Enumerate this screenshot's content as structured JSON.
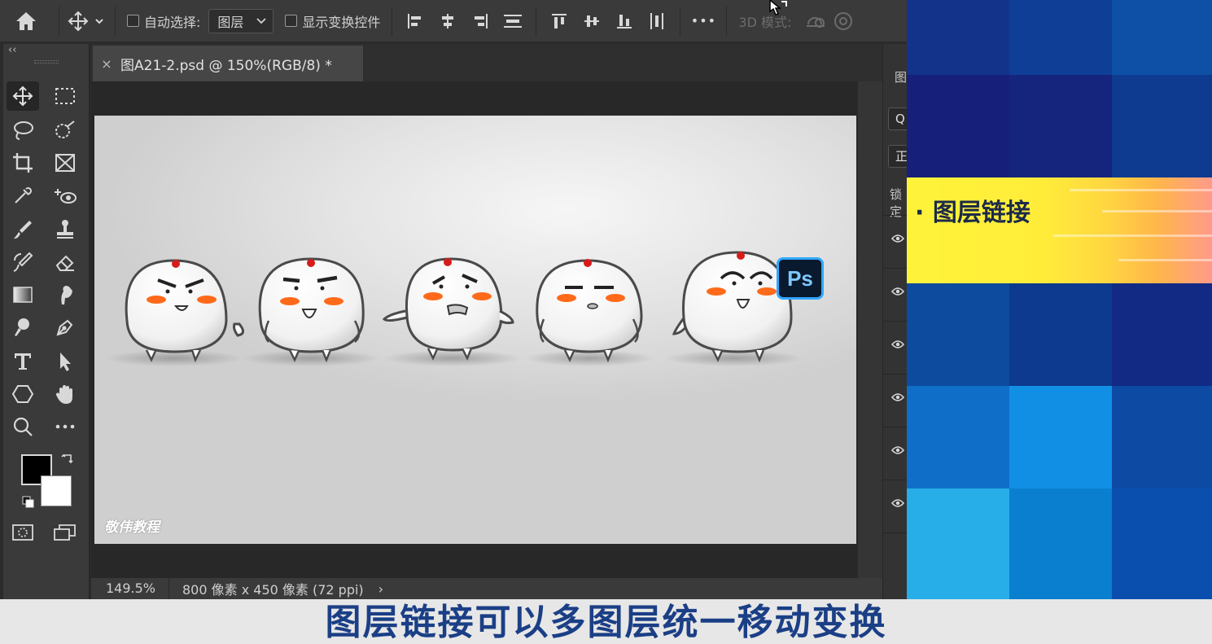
{
  "options_bar": {
    "auto_select_label": "自动选择:",
    "auto_select_target": "图层",
    "show_transform_label": "显示变换控件",
    "more_label": "•••",
    "mode_3d_label": "3D 模式:"
  },
  "document": {
    "tab_title": "图A21-2.psd @ 150%(RGB/8) *",
    "close_label": "×",
    "watermark": "敬伟教程",
    "ps_badge": "Ps"
  },
  "status_bar": {
    "zoom": "149.5%",
    "size": "800 像素 x 450 像素 (72 ppi)",
    "arrow": "›"
  },
  "toolbox": {
    "collapse_label": "‹‹"
  },
  "layers_panel": {
    "title_fragment": "图",
    "search_fragment": "Q",
    "blend_fragment": "正",
    "lock_fragment": "锁定"
  },
  "overlay": {
    "banner_text": "· 图层链接"
  },
  "subtitle": "图层链接可以多图层统一移动变换",
  "colors": {
    "foreground": "#000000",
    "background": "#ffffff",
    "banner_text": "#1c2a4a",
    "subtitle_text": "#1b3f86"
  }
}
